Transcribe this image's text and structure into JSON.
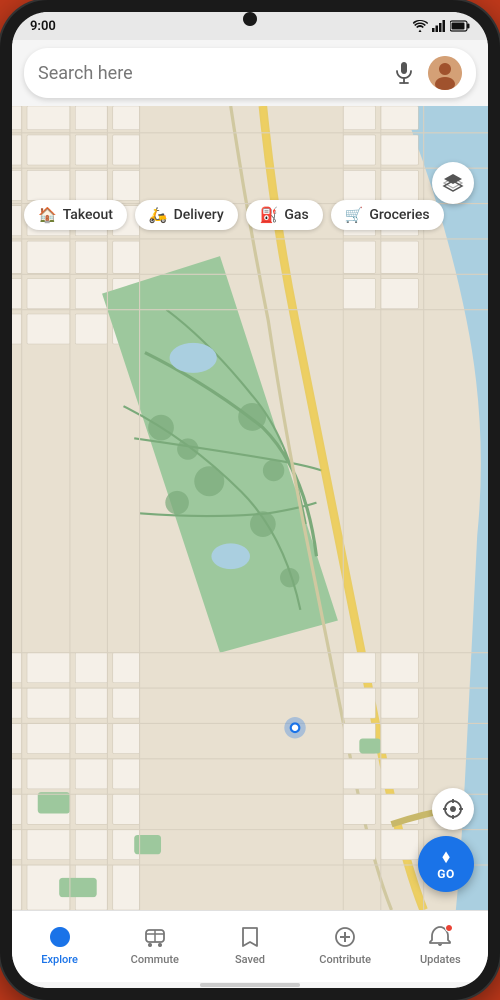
{
  "status": {
    "time": "9:00",
    "icons": [
      "wifi",
      "signal",
      "battery"
    ]
  },
  "search": {
    "placeholder": "Search here"
  },
  "chips": [
    {
      "id": "takeout",
      "label": "Takeout",
      "icon": "🏠"
    },
    {
      "id": "delivery",
      "label": "Delivery",
      "icon": "🛵"
    },
    {
      "id": "gas",
      "label": "Gas",
      "icon": "⛽"
    },
    {
      "id": "groceries",
      "label": "Groceries",
      "icon": "🛒"
    }
  ],
  "buttons": {
    "go_label": "GO",
    "layers_title": "Map layers",
    "location_title": "My location"
  },
  "nav": {
    "items": [
      {
        "id": "explore",
        "label": "Explore",
        "active": true,
        "badge": false
      },
      {
        "id": "commute",
        "label": "Commute",
        "active": false,
        "badge": false
      },
      {
        "id": "saved",
        "label": "Saved",
        "active": false,
        "badge": false
      },
      {
        "id": "contribute",
        "label": "Contribute",
        "active": false,
        "badge": false
      },
      {
        "id": "updates",
        "label": "Updates",
        "active": false,
        "badge": true
      }
    ]
  },
  "colors": {
    "accent_blue": "#1a73e8",
    "map_green": "#c8e6c9",
    "map_water": "#aacfe0",
    "map_road": "#fff",
    "map_bg": "#e8e0d0",
    "map_park": "#8ab88a"
  }
}
